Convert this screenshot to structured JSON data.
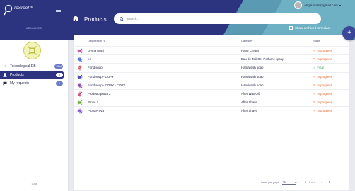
{
  "app": {
    "logo_text": "ToxTool™",
    "subtitle": "ADVANCED"
  },
  "sidebar": {
    "items": [
      {
        "label": "Toxicological DB",
        "badge": "4314"
      },
      {
        "label": "Products",
        "badge": "8"
      },
      {
        "label": "My requests",
        "badge": "0"
      }
    ],
    "footer": "Lunit"
  },
  "header": {
    "title": "Products",
    "user_email": "angel.urillo@gmail.com",
    "show_archived_label": "Show archived formulas"
  },
  "search": {
    "placeholder": "Search..."
  },
  "table": {
    "columns": {
      "description": "Description",
      "category": "Category",
      "state": "State"
    },
    "rows": [
      {
        "description": "crema mani",
        "category": "Hand Cream",
        "state": "In progress",
        "status": "progress",
        "thumb_color": "#c04fa8"
      },
      {
        "description": "ee",
        "category": "Eau de Toilette, Perfume spray",
        "state": "In progress",
        "status": "progress",
        "thumb_color": "#3c6ad0"
      },
      {
        "description": "Fond soap",
        "category": "Handwash soap",
        "state": "Final",
        "status": "final",
        "thumb_color": "#d24a4a"
      },
      {
        "description": "Fond soap - COPY",
        "category": "Handwash soap",
        "state": "In progress",
        "status": "progress",
        "thumb_color": "#3a3fae"
      },
      {
        "description": "Fond soap - COPY - COPY",
        "category": "Handwash soap",
        "state": "In progress",
        "status": "progress",
        "thumb_color": "#8a3fa8"
      },
      {
        "description": "Prodotto prova 2",
        "category": "After Wax Oil",
        "state": "In progress",
        "status": "progress",
        "thumb_color": "#c03d6e"
      },
      {
        "description": "Prova 1",
        "category": "After Shave",
        "state": "In progress",
        "status": "progress",
        "thumb_color": "#6fae3a"
      },
      {
        "description": "ProvaProva",
        "category": "After Shave",
        "state": "In progress",
        "status": "progress",
        "thumb_color": "#7a4ad0"
      }
    ]
  },
  "pagination": {
    "items_per_page_label": "Items per page:",
    "items_per_page": "25",
    "range": "1 - 8 of 8"
  },
  "colors": {
    "primary": "#2c3480",
    "accent": "#5a9ab3",
    "progress": "#e2692f",
    "final": "#3aa25c"
  }
}
